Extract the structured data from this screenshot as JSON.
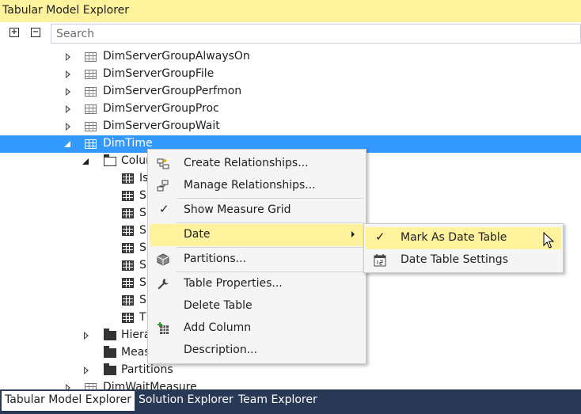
{
  "window": {
    "title": "Tabular Model Explorer"
  },
  "toolbar": {
    "expand_label": "+",
    "collapse_label": "−",
    "search_placeholder": "Search"
  },
  "tree": {
    "tables": [
      {
        "label": "DimServerGroupAlwaysOn"
      },
      {
        "label": "DimServerGroupFile"
      },
      {
        "label": "DimServerGroupPerfmon"
      },
      {
        "label": "DimServerGroupProc"
      },
      {
        "label": "DimServerGroupWait"
      }
    ],
    "selected_table": {
      "label": "DimTime"
    },
    "columns_folder": {
      "label": "Colur"
    },
    "columns": [
      {
        "label": "Is"
      },
      {
        "label": "S"
      },
      {
        "label": "S"
      },
      {
        "label": "S"
      },
      {
        "label": "S"
      },
      {
        "label": "S"
      },
      {
        "label": "S"
      },
      {
        "label": "S"
      },
      {
        "label": "T"
      }
    ],
    "hierarchies": {
      "label": "Hiera"
    },
    "measures": {
      "label": "Meas"
    },
    "partitions": {
      "label": "Partitions"
    },
    "next_table": {
      "label": "DimWaitMeasure"
    }
  },
  "context_menu": {
    "items": [
      {
        "label": "Create Relationships..."
      },
      {
        "label": "Manage Relationships..."
      },
      {
        "label": "Show Measure Grid",
        "checked": "✓"
      },
      {
        "label": "Date"
      },
      {
        "label": "Partitions..."
      },
      {
        "label": "Table Properties..."
      },
      {
        "label": "Delete Table"
      },
      {
        "label": "Add Column"
      },
      {
        "label": "Description..."
      }
    ]
  },
  "date_submenu": {
    "items": [
      {
        "label": "Mark As Date Table",
        "checked": "✓"
      },
      {
        "label": "Date Table Settings"
      }
    ]
  },
  "bottom_tabs": [
    {
      "label": "Tabular Model Explorer"
    },
    {
      "label": "Solution Explorer"
    },
    {
      "label": "Team Explorer"
    }
  ],
  "colors": {
    "title_bar": "#fff29d",
    "selection": "#3399ff",
    "menu_highlight": "#fff29d",
    "bottom_bar": "#293955"
  }
}
